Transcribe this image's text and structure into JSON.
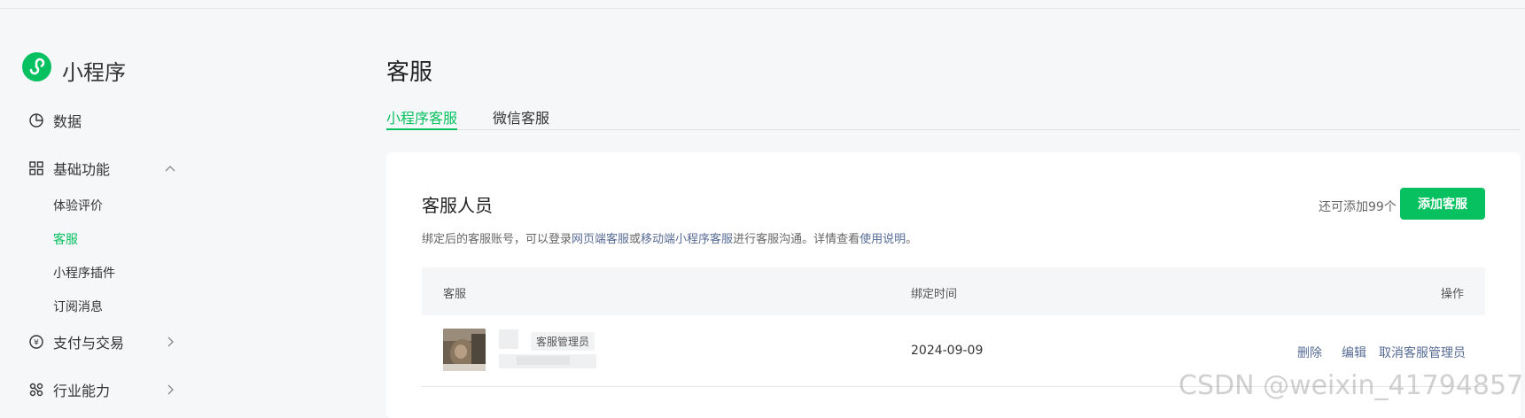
{
  "app": {
    "name": "小程序",
    "brand_color": "#07c160",
    "logo_icon": "miniprogram-logo-icon"
  },
  "sidebar": {
    "items": [
      {
        "label": "数据",
        "icon": "pie-chart-icon"
      },
      {
        "label": "基础功能",
        "icon": "grid-icon",
        "expanded": true
      },
      {
        "label": "支付与交易",
        "icon": "yuan-circle-icon"
      },
      {
        "label": "行业能力",
        "icon": "nodes-icon"
      }
    ],
    "sub_items": [
      {
        "label": "体验评价"
      },
      {
        "label": "客服",
        "active": true
      },
      {
        "label": "小程序插件"
      },
      {
        "label": "订阅消息"
      }
    ]
  },
  "main": {
    "title": "客服",
    "tabs": [
      {
        "label": "小程序客服",
        "active": true
      },
      {
        "label": "微信客服"
      }
    ],
    "card": {
      "title": "客服人员",
      "desc_prefix": "绑定后的客服账号，可以登录",
      "desc_link1": "网页端客服",
      "desc_or": "或",
      "desc_link2": "移动端小程序客服",
      "desc_mid": "进行客服沟通。详情查看",
      "desc_link3": "使用说明",
      "desc_end": "。",
      "remain": "还可添加99个",
      "add_button": "添加客服",
      "columns": [
        "客服",
        "绑定时间",
        "操作"
      ],
      "rows": [
        {
          "role": "客服管理员",
          "bind_time": "2024-09-09",
          "actions": [
            "删除",
            "编辑",
            "取消客服管理员"
          ]
        }
      ]
    }
  },
  "watermark": "CSDN @weixin_41794857"
}
